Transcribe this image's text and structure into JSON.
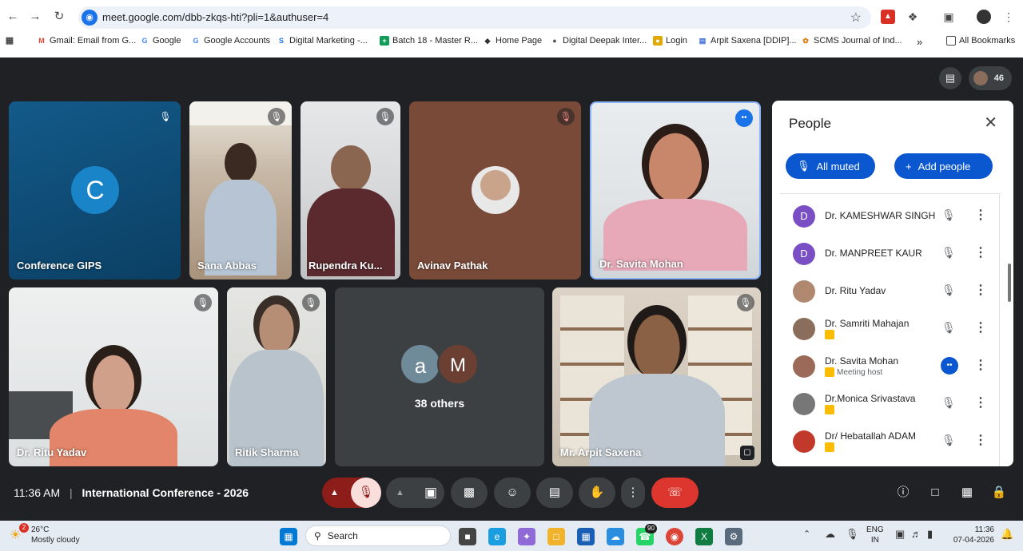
{
  "browser": {
    "url": "meet.google.com/dbb-zkqs-hti?pli=1&authuser=4",
    "bookmarks": [
      {
        "label": "Gmail: Email from G...",
        "icon": "gmail-icon",
        "color": "#ea4335"
      },
      {
        "label": "Google",
        "icon": "google-icon",
        "color": "#4285f4"
      },
      {
        "label": "Google Accounts",
        "icon": "google-icon",
        "color": "#4285f4"
      },
      {
        "label": "Digital Marketing -...",
        "icon": "s-icon",
        "color": "#1a73e8"
      },
      {
        "label": "Batch 18 - Master R...",
        "icon": "sheets-icon",
        "color": "#0f9d58"
      },
      {
        "label": "Home Page",
        "icon": "diamond-icon",
        "color": "#333333"
      },
      {
        "label": "Digital Deepak Inter...",
        "icon": "globe-icon",
        "color": "#555555"
      },
      {
        "label": "Login",
        "icon": "login-icon",
        "color": "#e0a800"
      },
      {
        "label": "Arpit Saxena [DDIP]...",
        "icon": "doc-icon",
        "color": "#3367d6"
      },
      {
        "label": "SCMS Journal of Ind...",
        "icon": "journal-icon",
        "color": "#e37400"
      }
    ],
    "all_bookmarks": "All Bookmarks",
    "more_bookmarks": "»"
  },
  "meet": {
    "participant_count": "46",
    "tiles": [
      {
        "name": "Conference GIPS",
        "avatar_letter": "C"
      },
      {
        "name": "Sana Abbas"
      },
      {
        "name": "Rupendra Ku..."
      },
      {
        "name": "Avinav Pathak"
      },
      {
        "name": "Dr. Savita Mohan"
      },
      {
        "name": "Dr. Ritu Yadav"
      },
      {
        "name": "Ritik Sharma"
      },
      {
        "name": "38 others",
        "avatar_a": "a",
        "avatar_m": "M"
      },
      {
        "name": "Mr. Arpit Saxena"
      }
    ],
    "time": "11:36 AM",
    "meeting_title": "International Conference - 2026"
  },
  "people_panel": {
    "title": "People",
    "all_muted": "All muted",
    "add_people": "Add people",
    "rows": [
      {
        "name": "Dr. KAMESHWAR SINGH",
        "avatar_letter": "D",
        "avatar_color": "#7b4fc4",
        "sub": ""
      },
      {
        "name": "Dr. MANPREET KAUR",
        "avatar_letter": "D",
        "avatar_color": "#7b4fc4",
        "sub": ""
      },
      {
        "name": "Dr. Ritu Yadav",
        "avatar_letter": "",
        "avatar_color": "#b08870",
        "sub": ""
      },
      {
        "name": "Dr. Samriti Mahajan",
        "avatar_letter": "",
        "avatar_color": "#8a6d5a",
        "sub": ""
      },
      {
        "name": "Dr. Savita Mohan",
        "avatar_letter": "",
        "avatar_color": "#9c6a58",
        "sub": "Meeting host"
      },
      {
        "name": "Dr.Monica Srivastava",
        "avatar_letter": "",
        "avatar_color": "#777777",
        "sub": ""
      },
      {
        "name": "Dr/ Hebatallah ADAM",
        "avatar_letter": "",
        "avatar_color": "#c0392b",
        "sub": ""
      }
    ]
  },
  "taskbar": {
    "temperature": "26°C",
    "weather": "Mostly cloudy",
    "weather_badge": "2",
    "search": "Search",
    "whatsapp_badge": "90",
    "lang_1": "ENG",
    "lang_2": "IN",
    "clock_time": "11:36",
    "clock_date": "07-04-2026"
  }
}
